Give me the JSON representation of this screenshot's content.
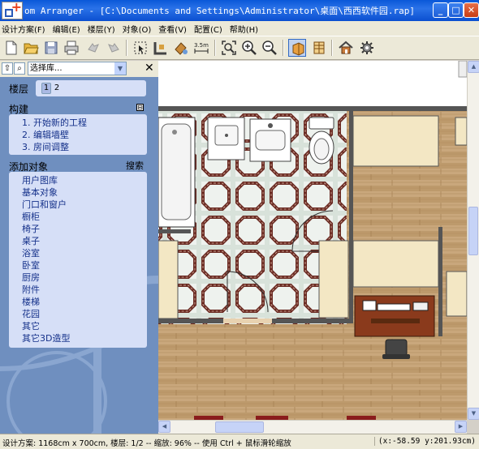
{
  "window": {
    "title": "om Arranger - [C:\\Documents and Settings\\Administrator\\桌面\\西西软件园.rap]",
    "minimize": "_",
    "maximize": "□",
    "close": "✕"
  },
  "menu": [
    "设计方案(F)",
    "编辑(E)",
    "楼层(Y)",
    "对象(O)",
    "查看(V)",
    "配置(C)",
    "帮助(H)"
  ],
  "toolbar": {
    "icons": [
      "new-file-icon",
      "open-folder-icon",
      "save-icon",
      "print-icon",
      "undo-icon",
      "redo-icon",
      "select-icon",
      "wall-icon",
      "paint-icon",
      "measure-icon",
      "zoom-fit-icon",
      "zoom-in-icon",
      "zoom-out-icon",
      "view-2d-icon",
      "view-3d-icon",
      "house-icon",
      "settings-icon"
    ],
    "measure_label": "3.5m"
  },
  "panel": {
    "library_select": "选择库...",
    "close": "✕",
    "floors_label": "楼层",
    "floors": [
      "1",
      "2"
    ],
    "build_label": "构建",
    "build_collapse": "⊟",
    "build_steps": [
      "1. 开始新的工程",
      "2. 编辑墙壁",
      "3. 房间调整"
    ],
    "add_objects_label": "添加对象",
    "search_label": "搜索",
    "object_categories": [
      "用户图库",
      "基本对象",
      "门口和窗户",
      "橱柜",
      "椅子",
      "桌子",
      "浴室",
      "卧室",
      "厨房",
      "附件",
      "楼梯",
      "花园",
      "其它",
      "其它3D造型"
    ]
  },
  "status": {
    "left": "设计方案: 1168cm x 700cm, 楼层: 1/2 -- 缩放: 96% -- 使用 Ctrl + 鼠标滑轮缩放",
    "right": "(x:-58.59 y:201.93cm)"
  },
  "colors": {
    "titlebar": "#0a58d8",
    "panel_bg": "#6f8fbf",
    "wood_floor": "#c7a57a",
    "tile_floor": "#d8e2da"
  }
}
